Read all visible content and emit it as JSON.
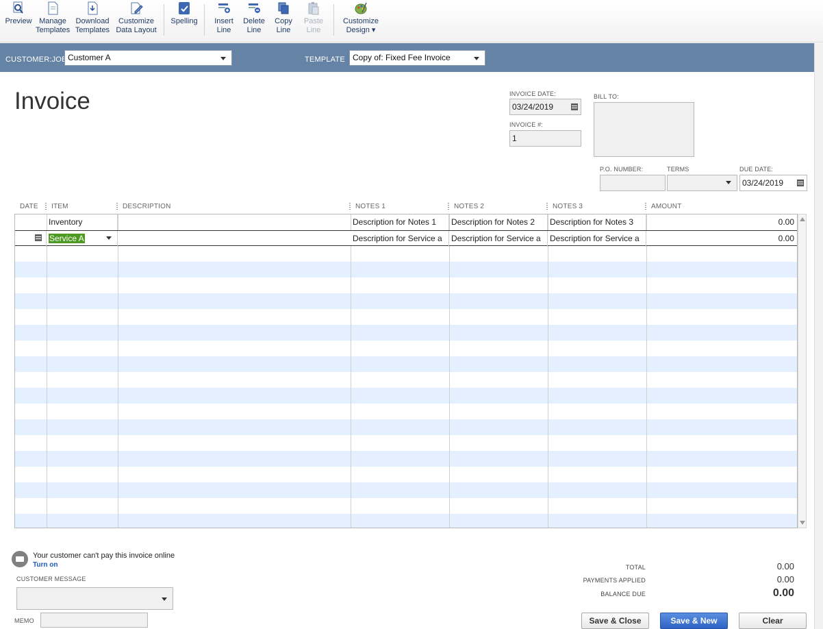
{
  "toolbar": {
    "preview": "Preview",
    "manage_templates": "Manage\nTemplates",
    "download_templates": "Download\nTemplates",
    "customize_layout": "Customize\nData Layout",
    "spelling": "Spelling",
    "insert_line": "Insert\nLine",
    "delete_line": "Delete\nLine",
    "copy_line": "Copy\nLine",
    "paste_line": "Paste\nLine",
    "customize_design": "Customize\nDesign ▾"
  },
  "header": {
    "customer_job_label": "CUSTOMER:JOB",
    "customer_job_value": "Customer A",
    "template_label": "TEMPLATE",
    "template_value": "Copy of: Fixed Fee Invoice"
  },
  "form": {
    "title": "Invoice",
    "invoice_date_label": "INVOICE DATE:",
    "invoice_date": "03/24/2019",
    "invoice_no_label": "INVOICE #:",
    "invoice_no": "1",
    "bill_to_label": "BILL TO:",
    "po_label": "P.O. NUMBER:",
    "terms_label": "TERMS",
    "due_date_label": "DUE DATE:",
    "due_date": "03/24/2019"
  },
  "grid": {
    "columns": [
      "DATE",
      "ITEM",
      "DESCRIPTION",
      "NOTES 1",
      "NOTES 2",
      "NOTES 3",
      "AMOUNT"
    ],
    "rows": [
      {
        "item": "Inventory",
        "notes1": "Description for Notes 1",
        "notes2": "Description for Notes 2",
        "notes3": "Description for Notes 3",
        "amount": "0.00"
      },
      {
        "item": "Service A",
        "notes1": "Description for Service a",
        "notes2": "Description for Service a",
        "notes3": "Description for Service a",
        "amount": "0.00"
      }
    ]
  },
  "bottom": {
    "pay_online_text": "Your customer can't pay this invoice online",
    "turn_on": "Turn on",
    "customer_message_label": "CUSTOMER MESSAGE",
    "memo_label": "MEMO",
    "total_label": "TOTAL",
    "total": "0.00",
    "payments_label": "PAYMENTS APPLIED",
    "payments": "0.00",
    "balance_label": "BALANCE DUE",
    "balance": "0.00"
  },
  "buttons": {
    "save_close": "Save & Close",
    "save_new": "Save & New",
    "clear": "Clear"
  },
  "colors": {
    "header_band": "#6583a4",
    "row_stripe": "#e4efff",
    "selection": "#4d9a21",
    "primary_button": "#2f63c4"
  }
}
